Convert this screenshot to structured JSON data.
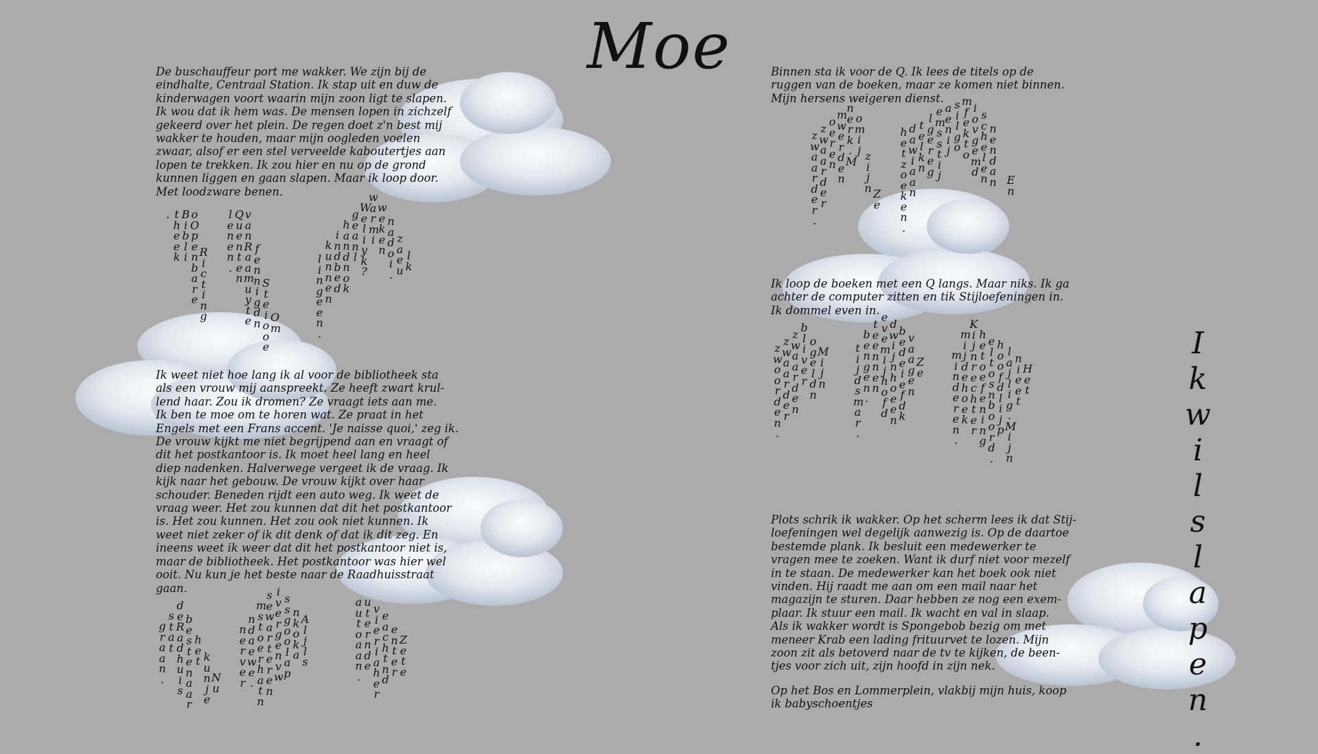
{
  "title": "Moe",
  "left": {
    "p1": "De buschauffeur port me wakker. We zijn bij de\neindhalte, Centraal Station. Ik stap uit en duw de\nkinderwagen voort waarin mijn zoon ligt te slapen.\nIk wou dat ik hem was. De mensen lopen in zichzelf\ngekeerd over het plein. De regen doet z'n best mij\nwakker te houden, maar mijn oogleden voelen\nzwaar, alsof er een stel verveelde kaboutertjes aan\nlopen te trekken. Ik zou hier en nu op de grond\nkunnen liggen en gaan slapen. Maar ik loop door.\nMet loodzware benen.",
    "p2": "Ik weet niet hoe lang ik al voor de bibliotheek sta\nals een vrouw mij aanspreekt. Ze heeft zwart krul-\nlend haar. Zou ik dromen? Ze vraagt iets aan me.\nIk ben te moe om te horen wat. Ze praat in het\nEngels met een Frans accent. 'Je naisse quoi,' zeg ik.\nDe vrouw kijkt me niet begrijpend aan en vraagt of\ndit het postkantoor is. Ik moet heel lang en heel\ndiep nadenken. Halverwege vergeet ik de vraag. Ik\nkijk naar het gebouw. De vrouw kijkt over haar\nschouder. Beneden rijdt een auto weg. Ik weet de\nvraag weer. Het zou kunnen dat dit het postkantoor\nis. Het zou kunnen. Het zou ook niet kunnen. Ik\nweet niet zeker of ik dit denk of dat ik dit zeg. En\nineens weet ik weer dat dit het postkantoor niet is,\nmaar de bibliotheek. Het postkantoor was hier wel\nooit. Nu kun je het beste naar de Raadhuisstraat\ngaan.",
    "v1": [
      ".",
      "theek",
      "Bibli",
      "oOpenbare",
      "Ricting",
      "",
      "",
      "lenen.",
      "Quenten",
      "vanRaamuyte",
      "fennigdn",
      "Steiooe",
      "Om",
      "",
      "",
      "",
      "",
      "lingeen.",
      "kunnen",
      "indbed",
      "handnok",
      "geanl",
      "Weliyk?",
      "warmi",
      "weken",
      "nadoi.",
      "zaeu",
      "lk",
      "Ik"
    ],
    "v2": [
      "graan.",
      "stat",
      "deRadhuis",
      "bestenaar",
      "het",
      "kunje",
      "Nu",
      "",
      "",
      "nerver",
      "ndaewe.",
      "mstoerhatn",
      "sewarteren",
      "ivergenvw",
      "ssgoolap",
      "nkoka",
      "Aljls",
      "",
      "",
      "",
      "",
      "",
      "autoaan.",
      "uternde",
      "vieriaher",
      "eachtnd",
      "enter",
      "Zete"
    ]
  },
  "right": {
    "p1": "Binnen sta ik voor de Q. Ik lees de titels op de\nruggen van de boeken, maar ze komen niet binnen.\nMijn hersens weigeren dienst.",
    "p2": "Ik loop de boeken met een Q langs. Maar niks. Ik ga\nachter de computer zitten en tik Stijloefeningen in.\nIk dommel even in.",
    "p3": "Plots schrik ik wakker. Op het scherm lees ik dat Stij-\nloefeningen wel degelijk aanwezig is. Op de daartoe\nbestemde plank. Ik besluit een medewerker te\nvragen mee te zoeken. Want ik durf niet voor mezelf\nin te staan. De medewerker kan het boek ook niet\nvinden. Hij raadt me aan om een mail naar het\nmagazijn te sturen. Daar hebben ze nog een exem-\nplaar. Ik stuur een mail. Ik wacht en val in slaap.\nAls ik wakker wordt is Spongebob bezig om met\nmeneer Krab een lading frituurvet te lozen. Mijn\nzoon zit als betoverd naar de tv te kijken, de been-\ntjes voor zich uit, zijn hoofd in zijn nek.",
    "p4": "Op het Bos en Lommerplein, vlakbij mijn huis, koop\nik babyschoentjes",
    "v1": [
      "zwaarder.",
      "zwaarder",
      "oeren",
      "mwerden",
      "nerk.M",
      "omij",
      "zijn",
      "Ze",
      "",
      "",
      "hetzoeken.",
      "dawiaan",
      "telkn",
      "lgereg",
      "emsstij",
      "aenij",
      "silgo",
      "mfekto",
      "iovgemd",
      "schelen",
      "nendan",
      "",
      "En"
    ],
    "v2": [
      "zwoorden.",
      "zwaarder",
      "zwaarden",
      "bliver",
      "ogeldn",
      "Mijn",
      "",
      "",
      "",
      "tijdsmar.",
      "bengen.",
      "teennen",
      "evemijhofd",
      "dwijnhoeen",
      "bedeiefdk",
      "vaagen",
      "Ze",
      "",
      "",
      "",
      "minderen.",
      "mijdehoek",
      "Kijnrechter",
      "hetoefening",
      "eltosnboord.",
      "hoofdlijp",
      "lajlig.Mijn",
      "nieet",
      "Het"
    ]
  },
  "side_text": "Ik wil slapen."
}
